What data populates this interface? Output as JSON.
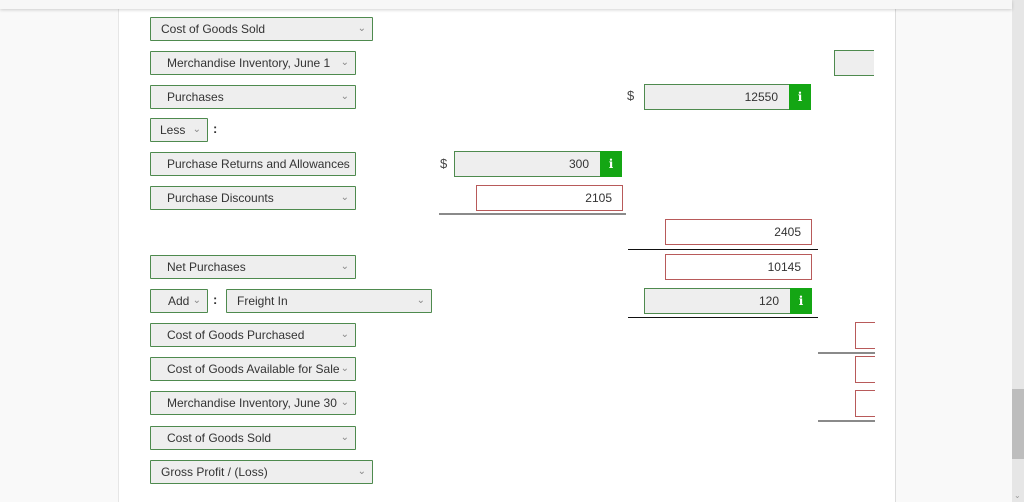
{
  "statement": {
    "header_select": "Cost of Goods Sold",
    "rows": {
      "inv_june1": "Merchandise Inventory, June 1",
      "purchases": "Purchases",
      "less": "Less",
      "returns": "Purchase Returns and Allowances",
      "discounts": "Purchase Discounts",
      "net_purchases": "Net Purchases",
      "add": "Add",
      "freight_in": "Freight In",
      "cogp": "Cost of Goods Purchased",
      "cogas": "Cost of Goods Available for Sale",
      "inv_june30": "Merchandise Inventory, June 30",
      "cogs": "Cost of Goods Sold",
      "gross_profit": "Gross Profit / (Loss)"
    },
    "colon": ":",
    "currency": "$",
    "values": {
      "purchases": "12550",
      "returns": "300",
      "discounts": "2105",
      "total_deductions": "2405",
      "net_purchases": "10145",
      "freight_in": "120",
      "inv_june1": "",
      "cogp": "",
      "cogas": "",
      "inv_june30": ""
    },
    "info_icon": "i",
    "colors": {
      "select_border": "#4e8a4e",
      "info_green": "#14a614",
      "error_red": "#b85a5a"
    }
  },
  "scrollbar": {
    "arrow": "⌄"
  }
}
